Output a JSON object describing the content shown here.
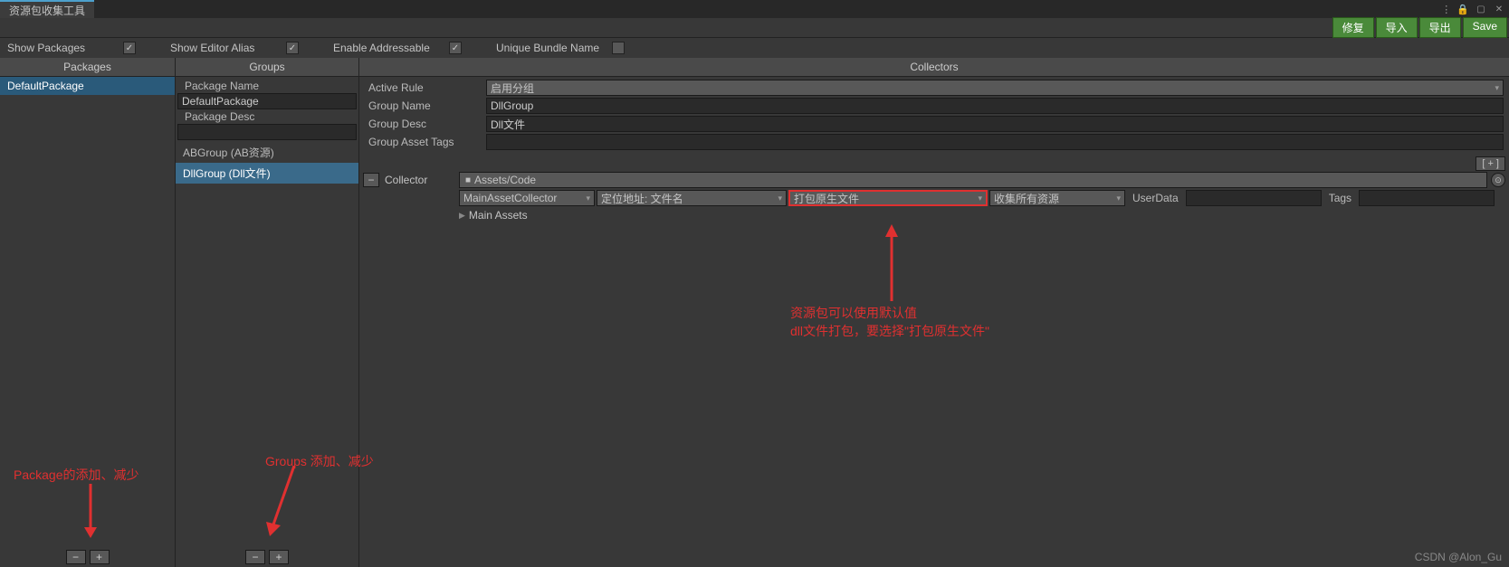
{
  "title": "资源包收集工具",
  "toolbar": {
    "fix": "修复",
    "import": "导入",
    "export": "导出",
    "save": "Save"
  },
  "options": {
    "showPackages": "Show Packages",
    "showEditorAlias": "Show Editor Alias",
    "enableAddressable": "Enable Addressable",
    "uniqueBundleName": "Unique Bundle Name"
  },
  "packages": {
    "header": "Packages",
    "items": [
      "DefaultPackage"
    ]
  },
  "groups": {
    "header": "Groups",
    "packageNameLabel": "Package Name",
    "packageName": "DefaultPackage",
    "packageDescLabel": "Package Desc",
    "packageDesc": "",
    "items": [
      "ABGroup (AB资源)",
      "DllGroup (Dll文件)"
    ]
  },
  "collectors": {
    "header": "Collectors",
    "activeRuleLabel": "Active Rule",
    "activeRule": "启用分组",
    "groupNameLabel": "Group Name",
    "groupName": "DllGroup",
    "groupDescLabel": "Group Desc",
    "groupDesc": "Dll文件",
    "groupAssetTagsLabel": "Group Asset Tags",
    "groupAssetTags": "",
    "addBtn": "[ + ]",
    "collectorLabel": "Collector",
    "path": "Assets/Code",
    "mainCollector": "MainAssetCollector",
    "addressRule": "定位地址: 文件名",
    "packRule": "打包原生文件",
    "filterRule": "收集所有资源",
    "userDataLabel": "UserData",
    "userData": "",
    "tagsLabel": "Tags",
    "tags": "",
    "mainAssets": "Main Assets"
  },
  "annotations": {
    "packageNote": "Package的添加、减少",
    "groupsNote": "Groups 添加、减少",
    "resNote1": "资源包可以使用默认值",
    "resNote2": "dll文件打包，要选择\"打包原生文件\""
  },
  "watermark": "CSDN @Alon_Gu"
}
